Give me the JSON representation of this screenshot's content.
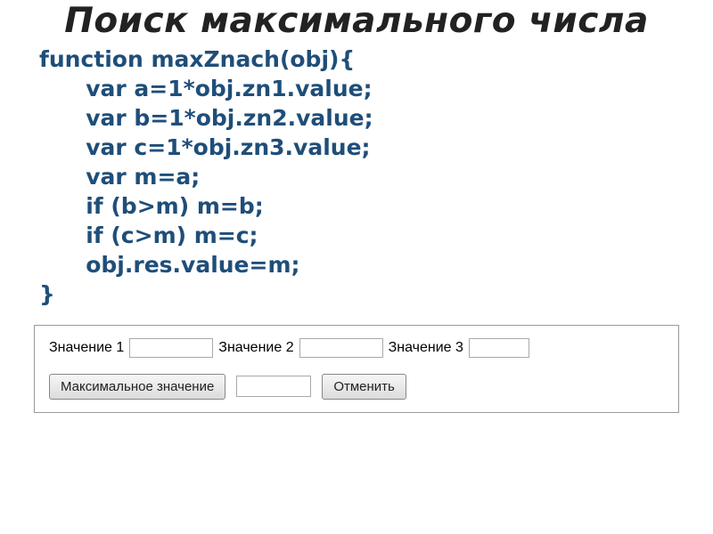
{
  "title": "Поиск максимального числа",
  "code": {
    "l1": "function maxZnach(obj){",
    "l2": "      var a=1*obj.zn1.value;",
    "l3": "      var b=1*obj.zn2.value;",
    "l4": "      var c=1*obj.zn3.value;",
    "l5": "      var m=a;",
    "l6": "      if (b>m) m=b;",
    "l7": "      if (c>m) m=c;",
    "l8": "      obj.res.value=m;",
    "l9": "}"
  },
  "form": {
    "label1": "Значение 1",
    "label2": "Значение 2",
    "label3": "Значение 3",
    "value1": "",
    "value2": "",
    "value3": "",
    "button_max": "Максимальное значение",
    "result": "",
    "button_cancel": "Отменить"
  }
}
